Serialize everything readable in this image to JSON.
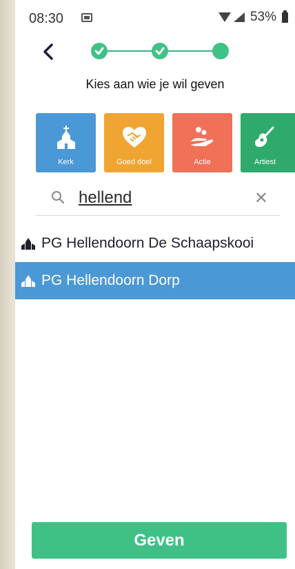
{
  "status_bar": {
    "time": "08:30",
    "battery": "53%"
  },
  "header": {
    "title": "Kies aan wie je wil geven",
    "steps_total": 3,
    "steps_completed": 2
  },
  "categories": [
    {
      "label": "Kerk",
      "color": "#4a98d6",
      "icon": "church-icon"
    },
    {
      "label": "Goed doel",
      "color": "#f0a533",
      "icon": "heart-handshake-icon"
    },
    {
      "label": "Actie",
      "color": "#f07058",
      "icon": "hand-coins-icon"
    },
    {
      "label": "Artiest",
      "color": "#2daa6c",
      "icon": "guitar-icon"
    }
  ],
  "search": {
    "value": "hellend",
    "clear_icon": "close-icon"
  },
  "results": [
    {
      "label": "PG Hellendoorn De Schaapskooi",
      "selected": false
    },
    {
      "label": "PG Hellendoorn Dorp",
      "selected": true
    }
  ],
  "give_button": {
    "label": "Geven"
  },
  "colors": {
    "accent": "#3fc186",
    "selected": "#4a98d6"
  }
}
